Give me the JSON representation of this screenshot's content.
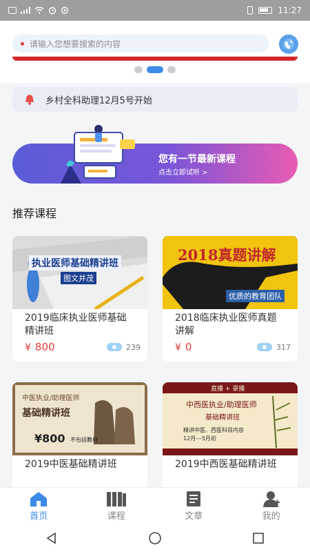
{
  "statusbar": {
    "left_icons": [
      "hd-icon",
      "signal-icon",
      "wifi-icon",
      "alarm-icon",
      "eye-icon"
    ],
    "time": "11:27"
  },
  "search": {
    "placeholder": "请输入您想要搜索的内容"
  },
  "carousel": {
    "count": 3,
    "active_index": 1
  },
  "notice": {
    "text": "乡村全科助理12月5号开始"
  },
  "promo": {
    "title": "您有一节最新课程",
    "subtitle": "点击立即试听 >"
  },
  "section": {
    "title": "推荐课程"
  },
  "courses": [
    {
      "title": "2019临床执业医师基础精讲班",
      "currency": "¥",
      "price": "800",
      "views": "239",
      "image_text": {
        "headline": "执业医师基础精讲班",
        "tag": "图文并茂"
      }
    },
    {
      "title": "2018临床执业医师真题讲解",
      "currency": "¥",
      "price": "0",
      "views": "317",
      "image_text": {
        "headline": "2018真题讲解",
        "tag": "优质的教育团队"
      }
    },
    {
      "title": "2019中医基础精讲班",
      "image_text": {
        "line1": "中医执业/助理医师",
        "line2": "基础精讲班",
        "line3": "¥800",
        "line4": "不包括教材"
      }
    },
    {
      "title": "2019中西医基础精讲班",
      "image_text": {
        "line1": "直播 + 录播",
        "line2": "中西医执业/助理医师",
        "line3": "基础精讲班",
        "line4": "精讲中医、西医科目内容",
        "line5": "12月---5月初"
      }
    }
  ],
  "tabs": [
    {
      "label": "首页",
      "icon": "home-icon",
      "active": true
    },
    {
      "label": "课程",
      "icon": "books-icon",
      "active": false
    },
    {
      "label": "文章",
      "icon": "article-icon",
      "active": false
    },
    {
      "label": "我的",
      "icon": "user-icon",
      "active": false
    }
  ],
  "colors": {
    "accent": "#3c8be8",
    "price": "#e23b3b",
    "tab_inactive": "#888888"
  }
}
